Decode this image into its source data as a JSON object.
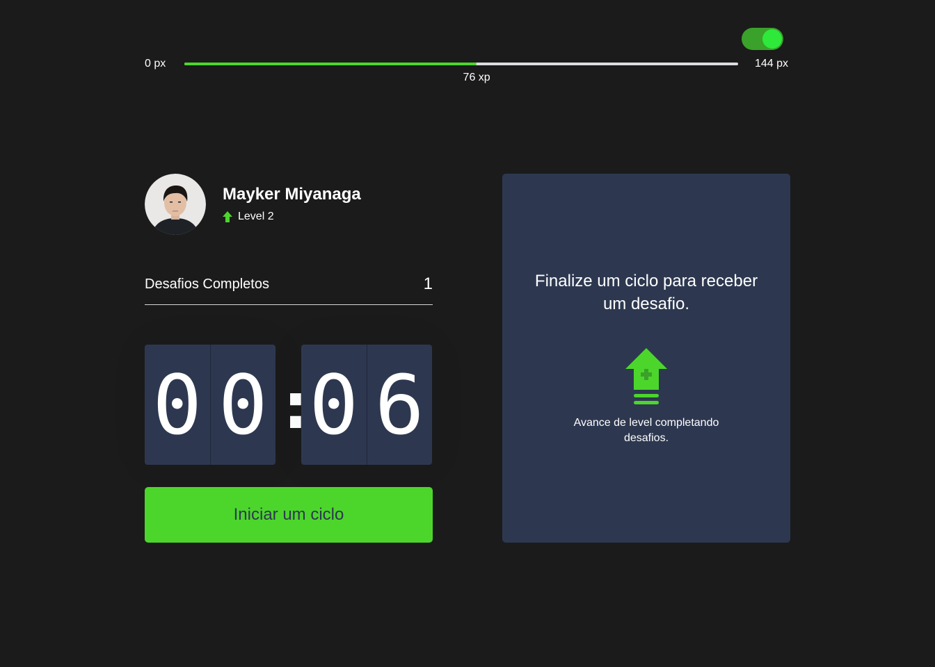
{
  "theme_toggle": {
    "state": "on",
    "color": "#3aa12a",
    "knob_color": "#2ee83a"
  },
  "xp_bar": {
    "min_label": "0 px",
    "max_label": "144 px",
    "current_label": "76 xp",
    "current": 76,
    "max": 144,
    "fill_color": "#4cd62b"
  },
  "profile": {
    "name": "Mayker Miyanaga",
    "level_label": "Level 2",
    "level_icon": "level-up-arrow-icon"
  },
  "completed_challenges": {
    "label": "Desafios Completos",
    "value": "1"
  },
  "countdown": {
    "minutes": [
      "0",
      "0"
    ],
    "separator": ":",
    "seconds": [
      "0",
      "6"
    ]
  },
  "start_button": {
    "label": "Iniciar um ciclo"
  },
  "challenge_box": {
    "title": "Finalize um ciclo para receber um desafio.",
    "icon": "level-up-icon",
    "description": "Avance de level completando desafios."
  },
  "colors": {
    "background": "#1b1b1b",
    "panel": "#2d3850",
    "accent_green": "#4cd62b",
    "text": "#ffffff"
  }
}
